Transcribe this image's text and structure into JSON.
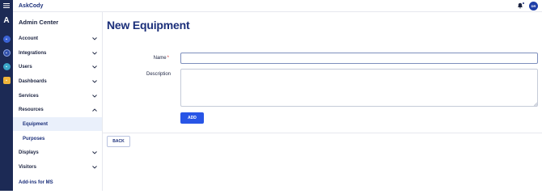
{
  "app": {
    "brand": "AskCody"
  },
  "header": {
    "bell_icon": "bell-icon",
    "avatar_initials": "DR"
  },
  "rail": {
    "logo": "A",
    "icons": [
      "calendar-icon",
      "services-icon",
      "displays-icon",
      "visitors-icon"
    ]
  },
  "sidebar": {
    "title": "Admin Center",
    "items": [
      {
        "label": "Account"
      },
      {
        "label": "Integrations"
      },
      {
        "label": "Users"
      },
      {
        "label": "Dashboards"
      },
      {
        "label": "Services"
      },
      {
        "label": "Resources"
      },
      {
        "label": "Displays"
      },
      {
        "label": "Visitors"
      },
      {
        "label": "Add-ins for MS"
      }
    ],
    "sub_items": [
      {
        "label": "Equipment",
        "active": true
      },
      {
        "label": "Purposes",
        "active": false
      }
    ]
  },
  "main": {
    "title": "New Equipment",
    "name_label": "Name",
    "required_mark": "*",
    "name_value": "",
    "description_label": "Description",
    "description_value": "",
    "add_button": "ADD",
    "back_button": "BACK"
  },
  "colors": {
    "accent": "#2855e6",
    "rail_bg": "#1c2a55",
    "title_text": "#1b2f7a",
    "active_bg": "#eaf0fb"
  }
}
